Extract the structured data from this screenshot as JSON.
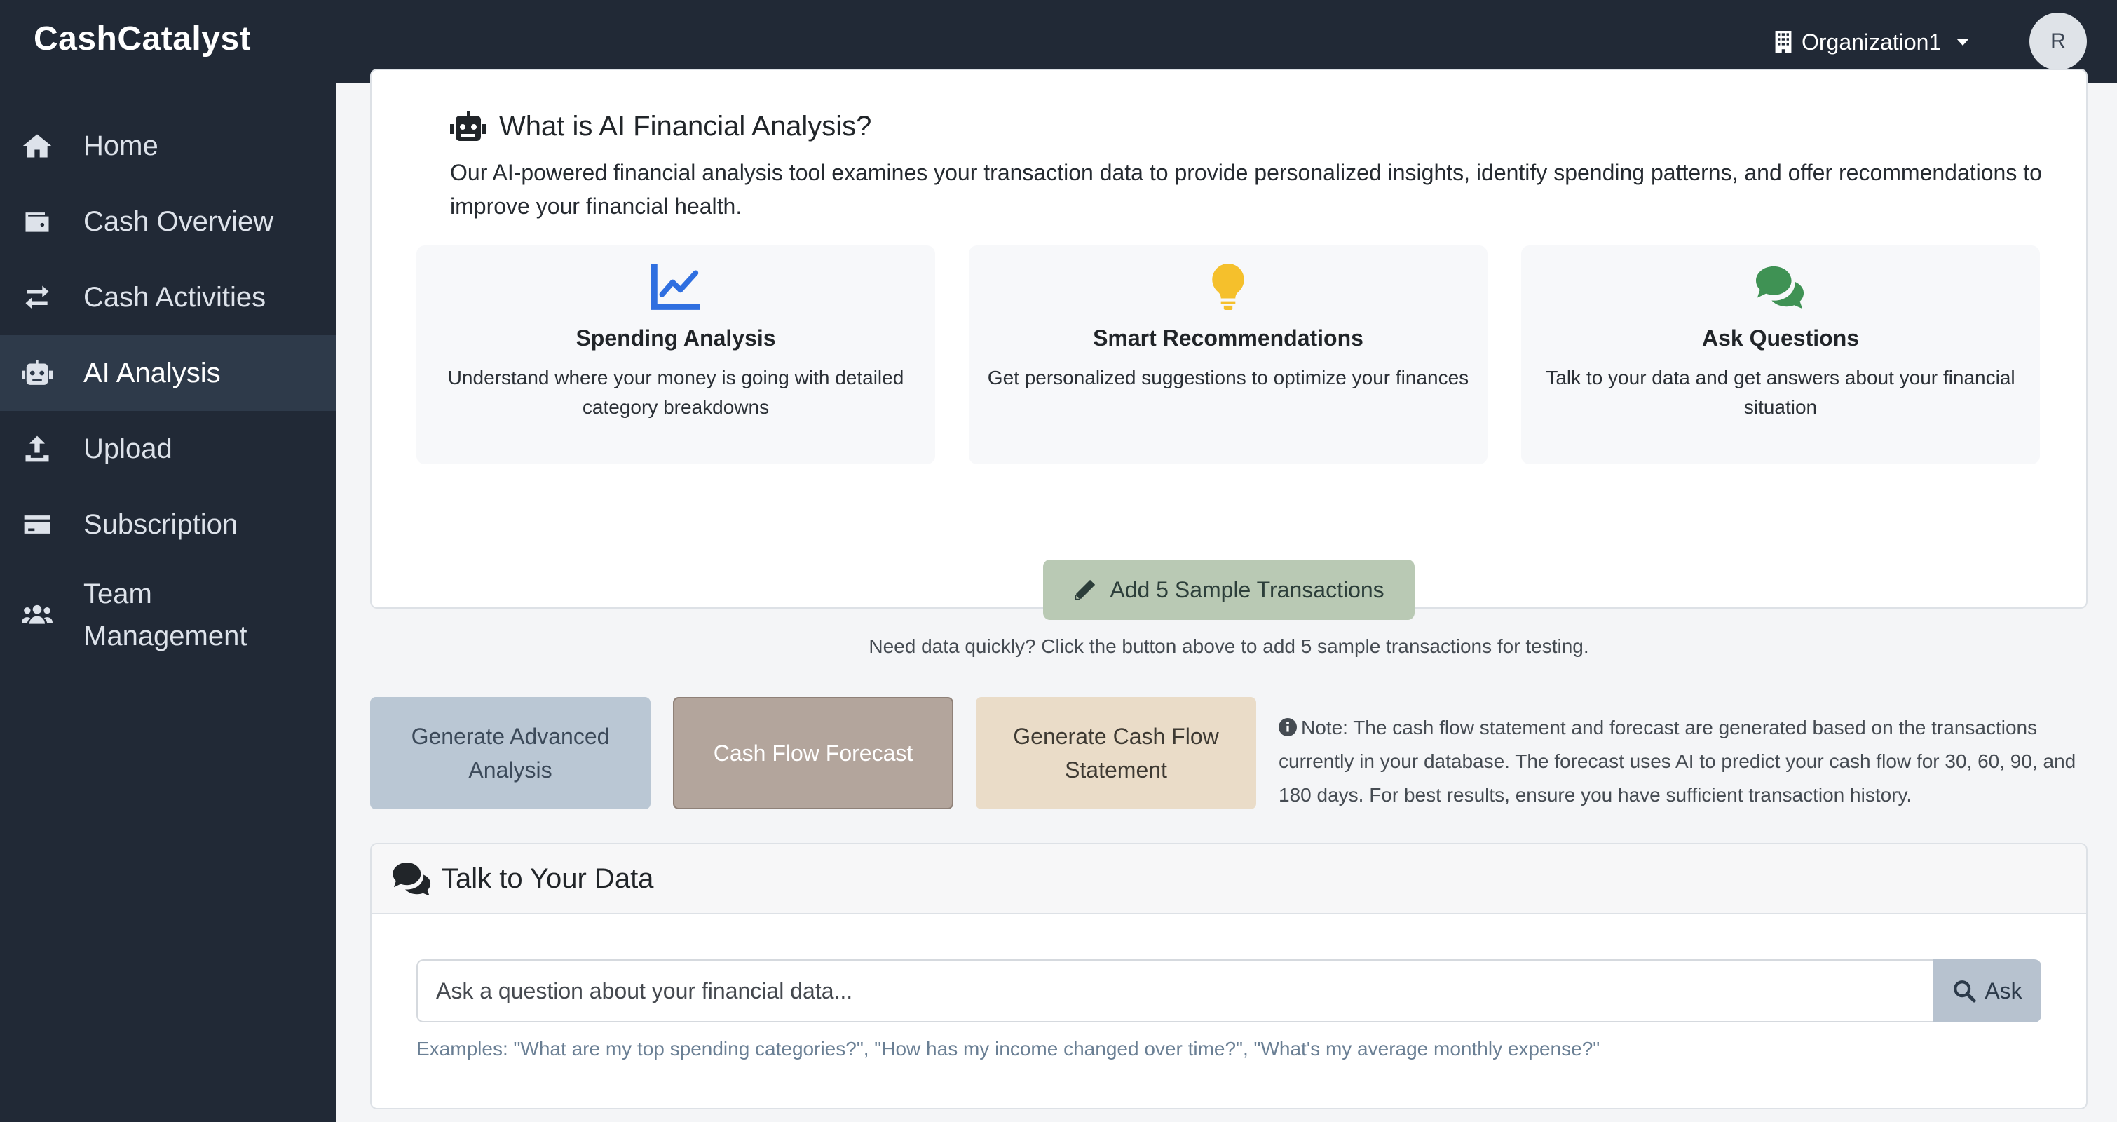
{
  "app": {
    "brand": "CashCatalyst",
    "organization": "Organization1",
    "avatar_initial": "R"
  },
  "sidebar": {
    "items": [
      {
        "label": "Home",
        "icon": "home-icon"
      },
      {
        "label": "Cash Overview",
        "icon": "wallet-icon"
      },
      {
        "label": "Cash Activities",
        "icon": "exchange-arrows-icon"
      },
      {
        "label": "AI Analysis",
        "icon": "robot-icon",
        "active": true
      },
      {
        "label": "Upload",
        "icon": "upload-icon"
      },
      {
        "label": "Subscription",
        "icon": "credit-card-icon"
      },
      {
        "label": "Team Management",
        "icon": "users-icon"
      }
    ]
  },
  "intro": {
    "title": "What is AI Financial Analysis?",
    "description": "Our AI-powered financial analysis tool examines your transaction data to provide personalized insights, identify spending patterns, and offer recommendations to improve your financial health.",
    "features": [
      {
        "title": "Spending Analysis",
        "description": "Understand where your money is going with detailed category breakdowns",
        "icon": "line-chart-icon",
        "color": "#2f6fe0"
      },
      {
        "title": "Smart Recommendations",
        "description": "Get personalized suggestions to optimize your finances",
        "icon": "lightbulb-icon",
        "color": "#f5c02c"
      },
      {
        "title": "Ask Questions",
        "description": "Talk to your data and get answers about your financial situation",
        "icon": "chat-bubbles-icon",
        "color": "#3f9254"
      }
    ]
  },
  "sample": {
    "button_label": "Add 5 Sample Transactions",
    "hint": "Need data quickly? Click the button above to add 5 sample transactions for testing."
  },
  "actions": {
    "advanced_analysis": "Generate Advanced Analysis",
    "cash_flow_forecast": "Cash Flow Forecast",
    "cash_flow_statement": "Generate Cash Flow Statement",
    "note": "Note: The cash flow statement and forecast are generated based on the transactions currently in your database. The forecast uses AI to predict your cash flow for 30, 60, 90, and 180 days. For best results, ensure you have sufficient transaction history."
  },
  "talk": {
    "title": "Talk to Your Data",
    "input_placeholder": "Ask a question about your financial data...",
    "ask_label": "Ask",
    "examples": "Examples: \"What are my top spending categories?\", \"How has my income changed over time?\", \"What's my average monthly expense?\""
  }
}
